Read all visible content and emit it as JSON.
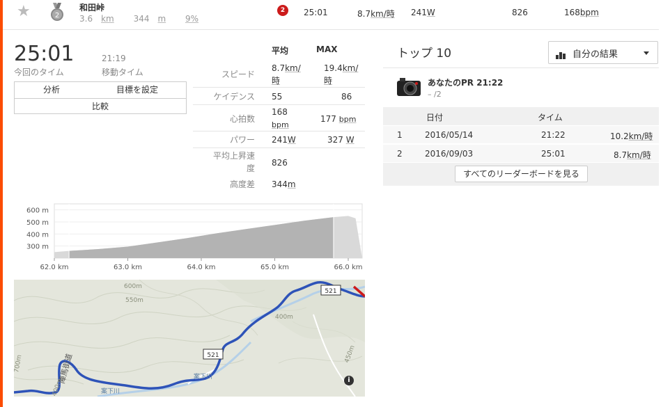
{
  "segment": {
    "name": "和田峠",
    "distance": "3.6",
    "distance_unit": "km",
    "elevation": "344",
    "elevation_unit": "m",
    "grade": "9%",
    "rank_badge": "2",
    "medal_rank": "2"
  },
  "effort_row": {
    "time": "25:01",
    "speed": "8.7",
    "speed_unit": "km/時",
    "power": "241",
    "power_unit": "W",
    "elevation_rate": "826",
    "heart_rate": "168",
    "heart_rate_unit": "bpm"
  },
  "summary": {
    "time": "25:01",
    "time_label": "今回のタイム",
    "moving_time": "21:19",
    "moving_time_label": "移動タイム"
  },
  "buttons": {
    "analysis": "分析",
    "set_goal": "目標を設定",
    "compare": "比較"
  },
  "stats": {
    "col_avg": "平均",
    "col_max": "MAX",
    "speed_label": "スピード",
    "speed_avg": "8.7",
    "speed_avg_unit_a": "km/",
    "speed_avg_unit_b": "時",
    "speed_max": "19.4",
    "speed_max_unit_a": "km/",
    "speed_max_unit_b": "時",
    "cadence_label": "ケイデンス",
    "cadence_avg": "55",
    "cadence_max": "86",
    "hr_label": "心拍数",
    "hr_avg": "168",
    "hr_avg_unit": "bpm",
    "hr_max": "177",
    "hr_max_unit": "bpm",
    "power_label": "パワー",
    "power_avg": "241",
    "power_avg_unit": "W",
    "power_max": "327",
    "power_max_unit": "W",
    "vam_label_a": "平均上昇速",
    "vam_label_b": "度",
    "vam_value": "826",
    "elev_label": "高度差",
    "elev_value": "344",
    "elev_unit": "m"
  },
  "chart_data": {
    "type": "area",
    "x_unit": "km",
    "y_unit": "m",
    "x_ticks": [
      "62.0 km",
      "63.0 km",
      "64.0 km",
      "65.0 km",
      "66.0 km"
    ],
    "y_ticks": [
      "600 m",
      "500 m",
      "400 m",
      "300 m"
    ],
    "xlim": [
      62.0,
      66.0
    ],
    "ylim": [
      200,
      650
    ],
    "segment_range": [
      62.2,
      65.8
    ],
    "x": [
      62.0,
      62.2,
      62.6,
      63.0,
      63.4,
      63.8,
      64.2,
      64.6,
      65.0,
      65.4,
      65.8,
      66.0,
      66.1
    ],
    "y": [
      250,
      260,
      275,
      295,
      330,
      365,
      405,
      440,
      475,
      510,
      540,
      550,
      530
    ]
  },
  "map": {
    "route_badge_1": "521",
    "route_badge_2": "521",
    "road_name": "陣馬街道",
    "contour_labels": [
      "600m",
      "550m",
      "400m",
      "450m",
      "700m",
      "400m"
    ],
    "river_labels": [
      "案下川",
      "案下川"
    ]
  },
  "leaderboard": {
    "title": "トップ 10",
    "dropdown_label": "自分の結果",
    "pr_title": "あなたのPR 21:22",
    "pr_sub": "– /2",
    "headers": {
      "date": "日付",
      "time": "タイム"
    },
    "rows": [
      {
        "rank": "1",
        "date": "2016/05/14",
        "time": "21:22",
        "speed": "10.2",
        "speed_unit": "km/時"
      },
      {
        "rank": "2",
        "date": "2016/09/03",
        "time": "25:01",
        "speed": "8.7",
        "speed_unit": "km/時"
      }
    ],
    "view_all": "すべてのリーダーボードを見る"
  }
}
